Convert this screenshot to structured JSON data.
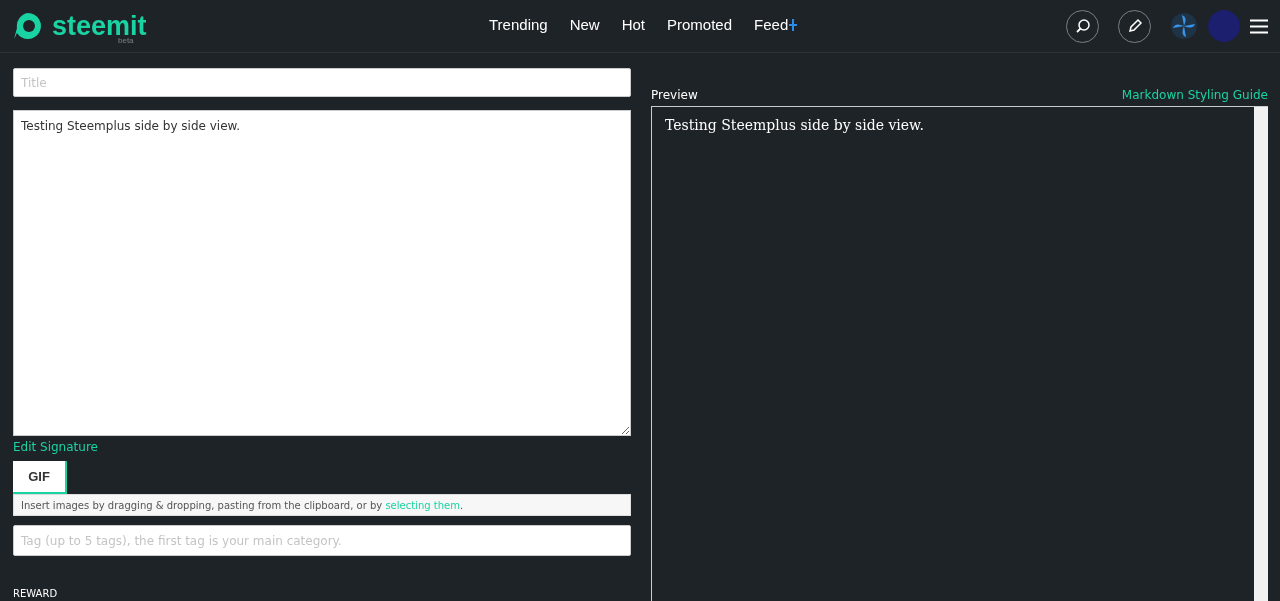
{
  "header": {
    "logo_text": "steemit",
    "logo_badge": "beta",
    "nav": [
      {
        "label": "Trending"
      },
      {
        "label": "New"
      },
      {
        "label": "Hot"
      },
      {
        "label": "Promoted"
      },
      {
        "label": "Feed"
      }
    ]
  },
  "editor": {
    "title": {
      "placeholder": "Title"
    },
    "body": {
      "value": "Testing Steemplus side by side view."
    },
    "edit_signature": "Edit Signature",
    "tabs": [
      {
        "label": "GIF",
        "selected": true
      }
    ],
    "upload_hint": "Insert images by dragging & dropping, pasting from the clipboard, or by ",
    "upload_link": "selecting them",
    "upload_hint_end": ".",
    "tags": {
      "placeholder": "Tag (up to 5 tags), the first tag is your main category."
    },
    "reward_label": "REWARD"
  },
  "preview": {
    "label": "Preview",
    "guide_link": "Markdown Styling Guide",
    "text": "Testing Steemplus side by side view."
  }
}
